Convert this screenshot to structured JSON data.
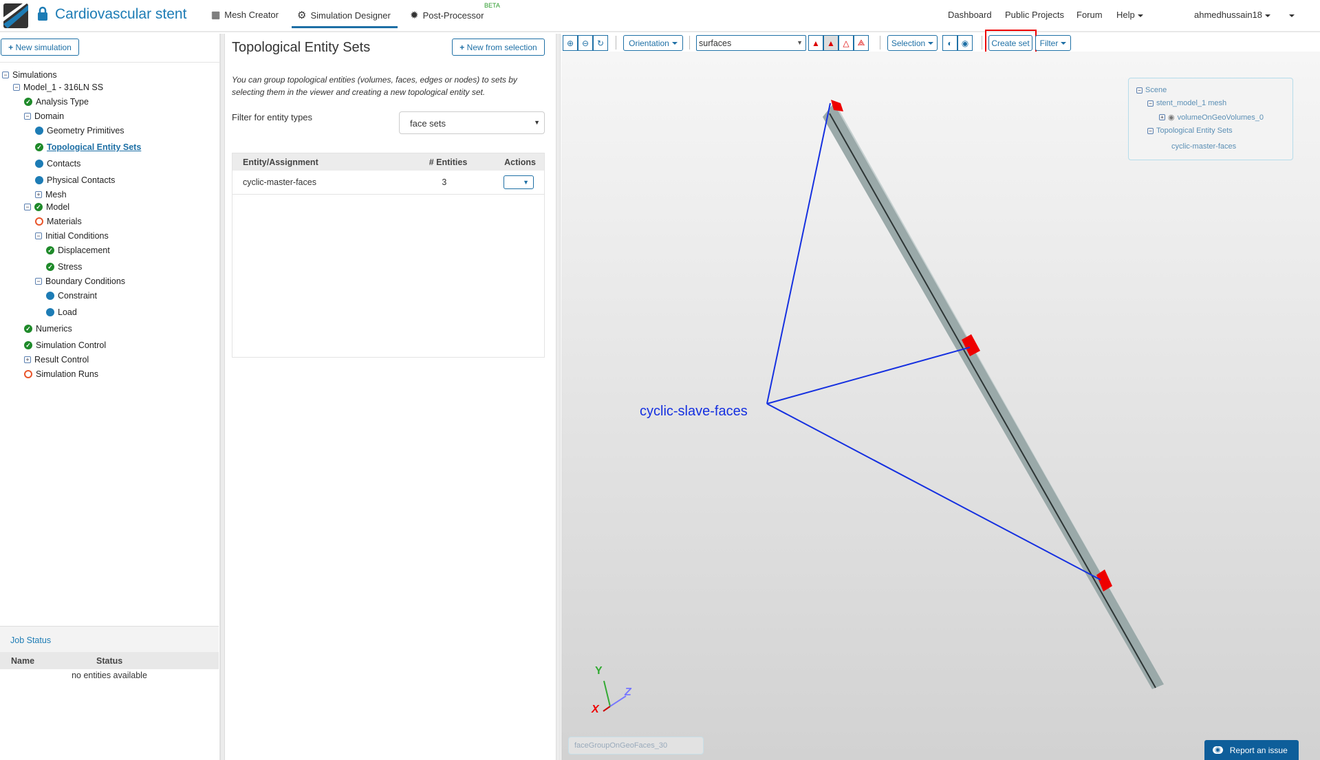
{
  "header": {
    "title": "Cardiovascular stent",
    "tabs": [
      {
        "label": "Mesh Creator"
      },
      {
        "label": "Simulation Designer"
      },
      {
        "label": "Post-Processor"
      }
    ],
    "beta": "BETA",
    "right": {
      "dashboard": "Dashboard",
      "public_projects": "Public Projects",
      "forum": "Forum",
      "help": "Help",
      "user": "ahmedhussain18"
    }
  },
  "left": {
    "new_simulation": "New simulation",
    "tree": {
      "simulations": "Simulations",
      "model1": "Model_1 - 316LN SS",
      "analysis_type": "Analysis Type",
      "domain": "Domain",
      "geometry_primitives": "Geometry Primitives",
      "topological_entity_sets": "Topological Entity Sets",
      "contacts": "Contacts",
      "physical_contacts": "Physical Contacts",
      "mesh": "Mesh",
      "model": "Model",
      "materials": "Materials",
      "initial_conditions": "Initial Conditions",
      "displacement": "Displacement",
      "stress": "Stress",
      "boundary_conditions": "Boundary Conditions",
      "constraint": "Constraint",
      "load": "Load",
      "numerics": "Numerics",
      "simulation_control": "Simulation Control",
      "result_control": "Result Control",
      "simulation_runs": "Simulation Runs"
    },
    "job_status": {
      "title": "Job Status",
      "columns": [
        "Name",
        "Status"
      ],
      "empty": "no entities available"
    }
  },
  "middle": {
    "title": "Topological Entity Sets",
    "new_from_selection": "New from selection",
    "description": "You can group topological entities (volumes, faces, edges or nodes) to sets by selecting them in the viewer and creating a new topological entity set.",
    "filter_label": "Filter for entity types",
    "filter_value": "face sets",
    "table": {
      "columns": [
        "Entity/Assignment",
        "# Entities",
        "Actions"
      ],
      "rows": [
        {
          "name": "cyclic-master-faces",
          "count": "3"
        }
      ]
    }
  },
  "viewer": {
    "toolbar": {
      "orientation": "Orientation",
      "render_mode": "surfaces",
      "selection": "Selection",
      "create_set": "Create set",
      "filter": "Filter"
    },
    "scene": {
      "root": "Scene",
      "mesh": "stent_model_1 mesh",
      "volume": "volumeOnGeoVolumes_0",
      "sets": "Topological Entity Sets",
      "set1": "cyclic-master-faces"
    },
    "annotation": "cyclic-slave-faces",
    "axes": {
      "x": "X",
      "y": "Y",
      "z": "Z"
    },
    "name_input": "faceGroupOnGeoFaces_30",
    "report_issue": "Report an issue"
  },
  "colors": {
    "accent": "#1d6fa5",
    "highlight": "#e00000",
    "annotation": "#1530e0"
  }
}
